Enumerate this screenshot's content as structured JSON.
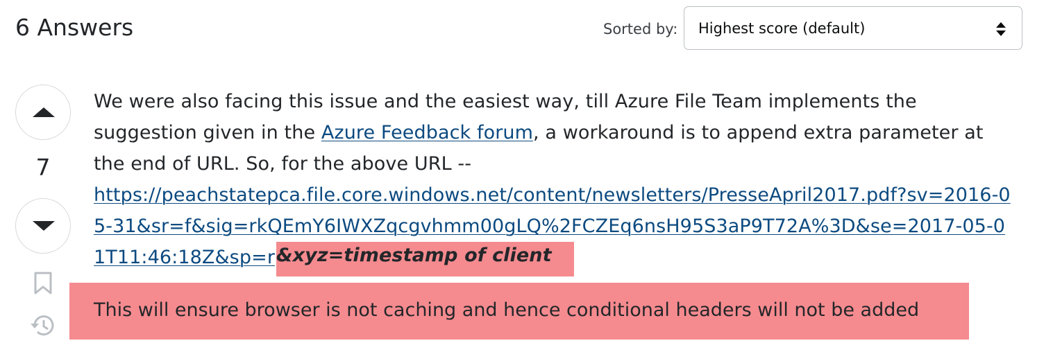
{
  "header": {
    "answers_title": "6 Answers",
    "sorted_label": "Sorted by:",
    "sort_selected": "Highest score (default)"
  },
  "vote": {
    "score": "7"
  },
  "answer": {
    "line1": "We were also facing this issue and the easiest way, till Azure File Team implements the suggestion given in the ",
    "link_text": "Azure Feedback forum",
    "line1_after": ", a workaround is to append extra parameter at the end of URL. So, for the above URL --",
    "url_text": "https://peachstatepca.file.core.windows.net/content/newsletters/PresseApril2017.pdf?sv=2016-05-31&sr=f&sig=rkQEmY6IWXZqcgvhmm00gLQ%2FCZEq6nsH95S3aP9T72A%3D&se=2017-05-01T11:46:18Z&sp=r",
    "highlight_param": "&xyz=timestamp of client",
    "callout": "This will ensure browser is not caching and hence conditional headers will not be added"
  },
  "icons": {
    "vote_up": "triangle-up-icon",
    "vote_down": "triangle-down-icon",
    "bookmark": "bookmark-icon",
    "history": "history-icon",
    "sort_arrows": "sort-arrows-icon"
  },
  "colors": {
    "link": "#0c4a80",
    "highlight": "#f58b8f",
    "text": "#232629"
  }
}
